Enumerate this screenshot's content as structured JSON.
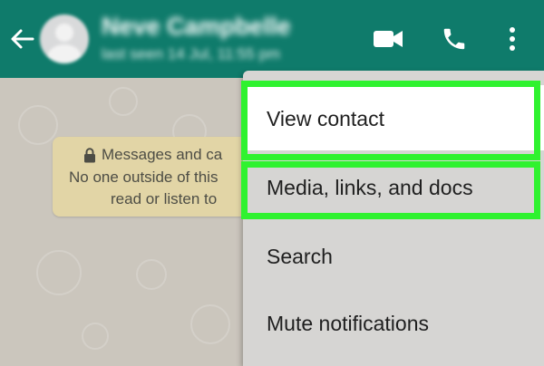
{
  "colors": {
    "header": "#0f7b6b",
    "chat_background": "#cbc6bd",
    "encryption_bubble": "#e2d5a6",
    "menu_background": "#d6d5d3",
    "highlight": "#2ff22f"
  },
  "header": {
    "back_icon": "arrow-left-icon",
    "contact_name": "Neve Campbelle",
    "last_seen": "last seen 14 Jul, 11:55 pm",
    "icons": [
      "video-call-icon",
      "phone-icon",
      "more-vert-icon"
    ]
  },
  "encryption_notice": {
    "lock_icon": "lock-icon",
    "line1": "Messages and ca",
    "line2": "No one outside of this",
    "line3": "read or listen to"
  },
  "menu": {
    "items": [
      {
        "label": "View contact",
        "highlighted": true
      },
      {
        "label": "Media, links, and docs",
        "highlighted": true
      },
      {
        "label": "Search",
        "highlighted": false
      },
      {
        "label": "Mute notifications",
        "highlighted": false
      }
    ]
  }
}
